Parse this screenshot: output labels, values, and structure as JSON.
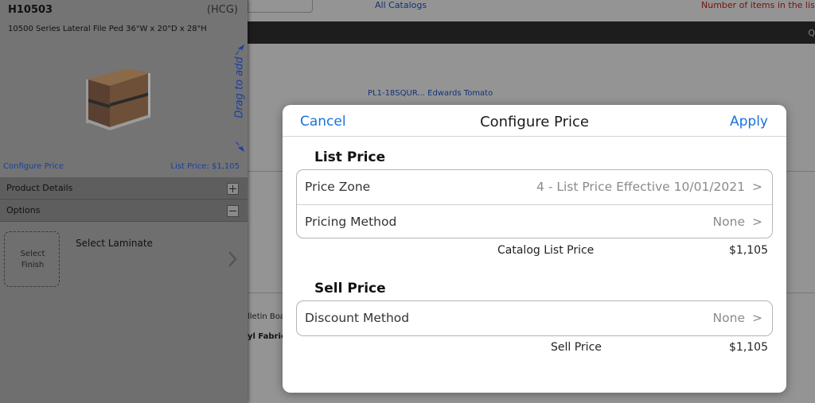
{
  "background": {
    "all_catalogs": "All Catalogs",
    "items_count_label": "Number of items in the list:",
    "bar_label": "Q",
    "product_link": "PL1-18SQUR... Edwards Tomato",
    "bulletin_text": "lletin Boa",
    "vinyl_text": "yl Fabric"
  },
  "product": {
    "sku": "H10503",
    "vendor": "(HCG)",
    "description": "10500 Series Lateral File Ped 36\"W x 20\"D x 28\"H",
    "image_icon": "file-pedestal-image",
    "drag_label": "Drag to add",
    "configure_price_link": "Configure Price",
    "list_price_label": "List Price: $1,105"
  },
  "sections": {
    "product_details": "Product Details",
    "options": "Options"
  },
  "options": {
    "finish_line1": "Select",
    "finish_line2": "Finish",
    "select_laminate": "Select Laminate"
  },
  "modal": {
    "cancel_label": "Cancel",
    "title": "Configure Price",
    "apply_label": "Apply",
    "list_price": {
      "heading": "List Price",
      "rows": [
        {
          "label": "Price Zone",
          "value": "4 - List Price Effective 10/01/2021"
        },
        {
          "label": "Pricing Method",
          "value": "None"
        }
      ],
      "catalog_label": "Catalog List Price",
      "catalog_value": "$1,105"
    },
    "sell_price": {
      "heading": "Sell Price",
      "rows": [
        {
          "label": "Discount Method",
          "value": "None"
        }
      ],
      "sell_label": "Sell Price",
      "sell_value": "$1,105"
    }
  },
  "colors": {
    "accent": "#1a73d9",
    "link": "#1a3fa0",
    "alert": "#cc2222"
  }
}
